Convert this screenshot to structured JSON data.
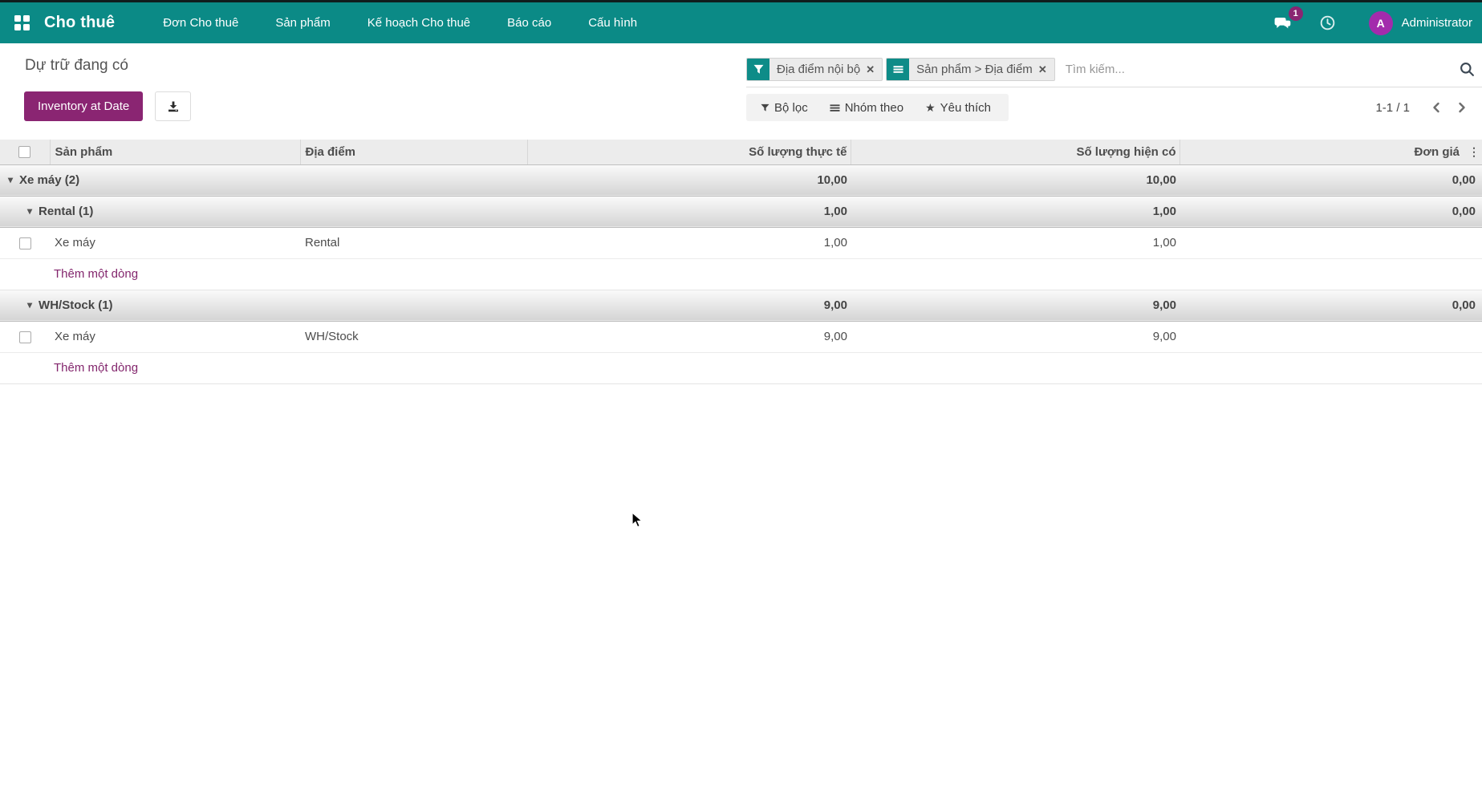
{
  "navbar": {
    "app_name": "Cho thuê",
    "menu_items": [
      "Đơn Cho thuê",
      "Sản phẩm",
      "Kế hoạch Cho thuê",
      "Báo cáo",
      "Cấu hình"
    ],
    "messages_badge": "1",
    "user_initial": "A",
    "user_name": "Administrator"
  },
  "control_panel": {
    "title": "Dự trữ đang có",
    "primary_button_label": "Inventory at Date",
    "filters_button_label": "Bộ lọc",
    "groupby_button_label": "Nhóm theo",
    "favorites_button_label": "Yêu thích",
    "pager_text": "1-1 / 1"
  },
  "search": {
    "placeholder": "Tìm kiếm...",
    "facets": [
      {
        "icon": "filter-icon",
        "label": "Địa điểm nội bộ",
        "remove_glyph": "✕"
      },
      {
        "icon": "group-by-icon",
        "label": "Sản phẩm > Địa điểm",
        "remove_glyph": "✕"
      }
    ]
  },
  "table": {
    "columns": {
      "product": "Sản phẩm",
      "location": "Địa điểm",
      "qty_real": "Số lượng thực tế",
      "qty_on_hand": "Số lượng hiện có",
      "unit_price": "Đơn giá"
    },
    "rows": [
      {
        "type": "group",
        "level": 0,
        "label": "Xe máy (2)",
        "qty_real": "10,00",
        "qty_on_hand": "10,00",
        "unit_price": "0,00"
      },
      {
        "type": "group",
        "level": 1,
        "label": "Rental (1)",
        "qty_real": "1,00",
        "qty_on_hand": "1,00",
        "unit_price": "0,00"
      },
      {
        "type": "data",
        "product": "Xe máy",
        "location": "Rental",
        "qty_real": "1,00",
        "qty_on_hand": "1,00",
        "unit_price": ""
      },
      {
        "type": "add_line",
        "label": "Thêm một dòng"
      },
      {
        "type": "group",
        "level": 1,
        "label": "WH/Stock (1)",
        "qty_real": "9,00",
        "qty_on_hand": "9,00",
        "unit_price": "0,00"
      },
      {
        "type": "data",
        "product": "Xe máy",
        "location": "WH/Stock",
        "qty_real": "9,00",
        "qty_on_hand": "9,00",
        "unit_price": ""
      },
      {
        "type": "add_line",
        "label": "Thêm một dòng"
      }
    ]
  },
  "colors": {
    "navbar_bg": "#0b8a86",
    "primary_button_bg": "#8a2572",
    "badge_bg": "#8a2572",
    "avatar_bg": "#a32bac",
    "add_line_link": "#83266d",
    "facet_icon_bg": "#0e8c88"
  }
}
